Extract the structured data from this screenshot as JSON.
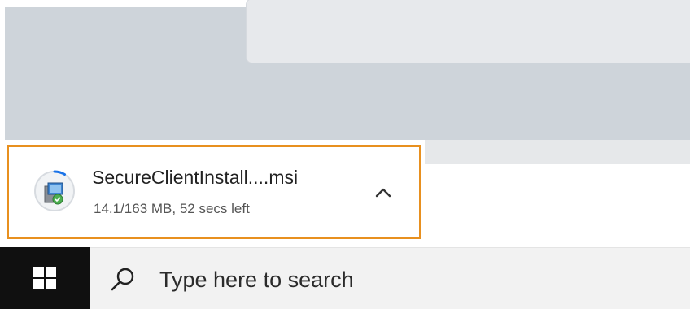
{
  "download": {
    "file_name": "SecureClientInstall....msi",
    "status": "14.1/163 MB, 52 secs left",
    "progress": 0.087,
    "icon": "msi-installer-icon",
    "expand_icon": "chevron-up-icon"
  },
  "taskbar": {
    "start_icon": "windows-logo-icon",
    "search_icon": "search-icon",
    "search_placeholder": "Type here to search"
  },
  "colors": {
    "highlight_border": "#e8901f",
    "progress_ring": "#1a73e8",
    "taskbar_start": "#101010",
    "page_background": "#ced4da"
  }
}
